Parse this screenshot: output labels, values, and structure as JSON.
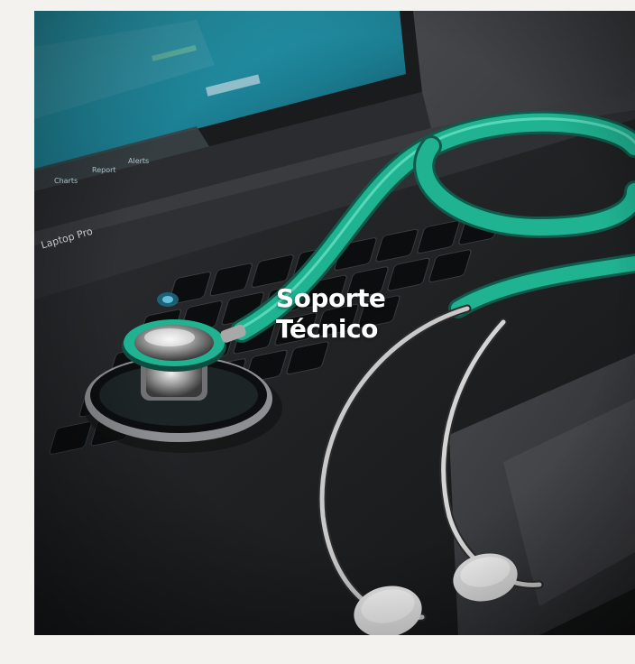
{
  "hero": {
    "title_line1": "Soporte",
    "title_line2": "Técnico",
    "laptop_label": "Laptop Pro",
    "screen_labels": [
      "Charts",
      "Report",
      "Alerts"
    ]
  },
  "colors": {
    "page_bg": "#f4f2ee",
    "stethoscope_tube": "#1fb392",
    "title_text": "#ffffff"
  }
}
